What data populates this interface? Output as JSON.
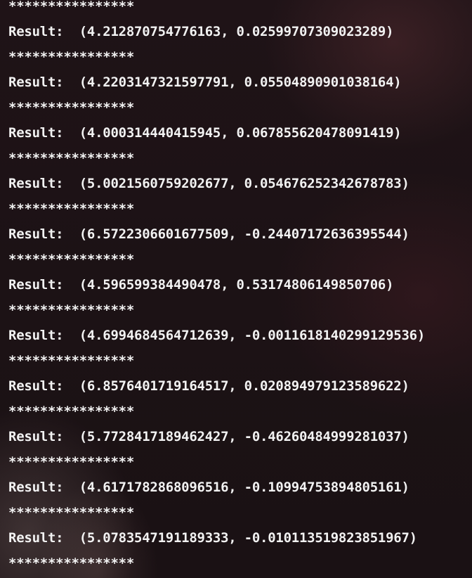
{
  "terminal": {
    "lines": [
      {
        "text": "****************",
        "kind": "separator"
      },
      {
        "text": "Result:  (4.212870754776163, 0.02599707309023289)",
        "kind": "result"
      },
      {
        "text": "****************",
        "kind": "separator"
      },
      {
        "text": "Result:  (4.2203147321597791, 0.05504890901038164)",
        "kind": "result"
      },
      {
        "text": "****************",
        "kind": "separator"
      },
      {
        "text": "Result:  (4.000314440415945, 0.067855620478091419)",
        "kind": "result"
      },
      {
        "text": "****************",
        "kind": "separator"
      },
      {
        "text": "Result:  (5.0021560759202677, 0.054676252342678783)",
        "kind": "result"
      },
      {
        "text": "****************",
        "kind": "separator"
      },
      {
        "text": "Result:  (6.5722306601677509, -0.24407172636395544)",
        "kind": "result"
      },
      {
        "text": "****************",
        "kind": "separator"
      },
      {
        "text": "Result:  (4.596599384490478, 0.53174806149850706)",
        "kind": "result"
      },
      {
        "text": "****************",
        "kind": "separator"
      },
      {
        "text": "Result:  (4.6994684564712639, -0.0011618140299129536)",
        "kind": "result"
      },
      {
        "text": "****************",
        "kind": "separator"
      },
      {
        "text": "Result:  (6.857640171916451 7, 0.020894979123589622)",
        "kind": "result"
      },
      {
        "text": "****************",
        "kind": "separator"
      },
      {
        "text": "Result:  (5.7728417189462427, -0.46260484999281037)",
        "kind": "result"
      },
      {
        "text": "****************",
        "kind": "separator"
      },
      {
        "text": "Result:  (4.6171782868096516, -0.10994753894805161)",
        "kind": "result"
      },
      {
        "text": "****************",
        "kind": "separator"
      },
      {
        "text": "Result:  (5.0783547191189333, -0.010113519823851967)",
        "kind": "result"
      },
      {
        "text": "****************",
        "kind": "separator"
      }
    ],
    "colors": {
      "foreground": "#f2f2f2",
      "background": "#1d1215"
    }
  }
}
